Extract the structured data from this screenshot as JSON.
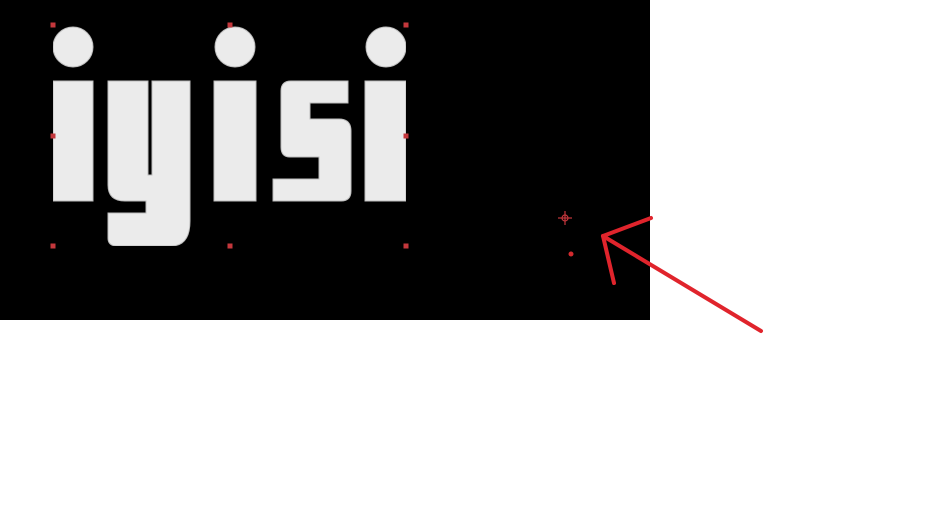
{
  "canvas": {
    "background": "#000000",
    "text_object": {
      "text": "iyisi",
      "fill_color": "#ebebeb"
    },
    "selection": {
      "handle_color": "#c4373c",
      "handles": [
        "top-left",
        "top-center",
        "top-right",
        "middle-left",
        "middle-right",
        "bottom-left",
        "bottom-center",
        "bottom-right"
      ]
    },
    "transform_center_icon": "crosshair-icon",
    "anchor_point_icon": "dot-icon"
  },
  "annotation": {
    "icon": "arrow-icon",
    "color": "#e0242c"
  }
}
